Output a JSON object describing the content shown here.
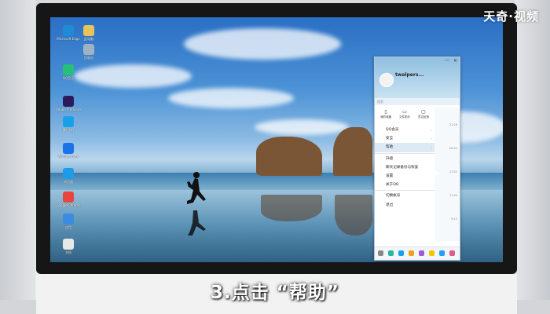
{
  "watermark": "天奇·视频",
  "caption": "3.点击 “帮助”",
  "desktop_icons": [
    {
      "label": "Microsoft Edge",
      "icon": "edge-icon",
      "color": "#1f8bd6"
    },
    {
      "label": "此电脑",
      "icon": "computer-icon",
      "color": "#e8c35a"
    },
    {
      "label": "回收站",
      "icon": "recycle-bin-icon",
      "color": "#9fb2c4"
    },
    {
      "label": "QQ音乐",
      "icon": "qq-music-icon",
      "color": "#27c07a"
    },
    {
      "label": "Adobe Premiere",
      "icon": "premiere-icon",
      "color": "#2a1b5c"
    },
    {
      "label": "腾讯QQ",
      "icon": "qq-icon",
      "color": "#1aa0e8"
    },
    {
      "label": "Wondershare",
      "icon": "wondershare-icon",
      "color": "#1a73e8"
    },
    {
      "label": "浏览器",
      "icon": "browser-icon",
      "color": "#1e9be9"
    },
    {
      "label": "Google Chrome",
      "icon": "chrome-icon",
      "color": "#e8453c"
    },
    {
      "label": "应用",
      "icon": "app-icon",
      "color": "#3b8be0"
    },
    {
      "label": "文档",
      "icon": "document-icon",
      "color": "#e8e8e8"
    }
  ],
  "qq": {
    "nickname": "twalpers...",
    "search_placeholder": "搜索",
    "tools": [
      {
        "label": "我的收藏",
        "icon": "favorites-icon"
      },
      {
        "label": "文件助手",
        "icon": "file-assistant-icon"
      },
      {
        "label": "意见反馈",
        "icon": "feedback-icon"
      }
    ],
    "menu": [
      {
        "label": "QQ会员",
        "arrow": true
      },
      {
        "label": "安全",
        "arrow": true
      },
      {
        "label": "帮助",
        "arrow": true,
        "highlight": true
      },
      {
        "label": "升级",
        "arrow": false
      },
      {
        "label": "聊天记录备份与恢复",
        "arrow": false
      },
      {
        "label": "设置",
        "arrow": false
      },
      {
        "label": "关于QQ",
        "arrow": false
      },
      {
        "label": "切换帐号",
        "arrow": false
      },
      {
        "label": "退出",
        "arrow": false
      }
    ],
    "times": [
      "21:26",
      "20:44",
      "17:02",
      "11:40",
      "9:13"
    ]
  },
  "colors": {
    "accent": "#1aa0e8",
    "menu_highlight": "#dde9f5"
  }
}
